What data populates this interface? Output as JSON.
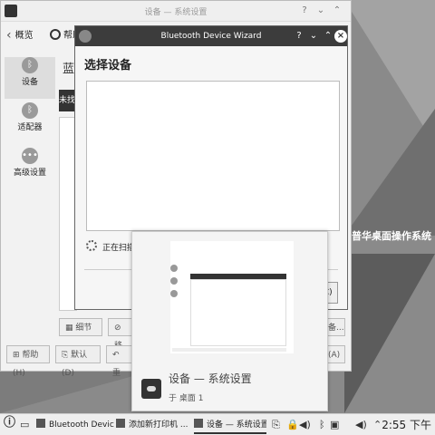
{
  "settings_window": {
    "title": "设备 — 系统设置",
    "back_label": "概览",
    "help_label": "帮助",
    "sidebar_items": [
      {
        "label": "设备",
        "icon": "bluetooth-icon"
      },
      {
        "label": "适配器",
        "icon": "bluetooth-icon"
      },
      {
        "label": "高级设置",
        "icon": "more-icon"
      }
    ],
    "page_title": "蓝牙",
    "dark_button_label": "未找到",
    "details_label": "细节",
    "remove_label": "移",
    "add_label": "备...",
    "bottom_buttons": {
      "help": "帮助(H)",
      "defaults": "默认(D)",
      "reset": "重",
      "apply": "(A)"
    }
  },
  "wizard": {
    "title": "Bluetooth Device Wizard",
    "heading": "选择设备",
    "scanning_text": "正在扫描",
    "cancel_label": "(C)"
  },
  "desktop": {
    "brand_text": "普华桌面操作系统"
  },
  "preview": {
    "title": "设备  — 系统设置",
    "subtitle": "于 桌面 1"
  },
  "taskbar": {
    "tasks": [
      {
        "label": "Bluetooth Devic",
        "icon": "bluetooth-icon"
      },
      {
        "label": "添加新打印机 ...",
        "icon": "printer-icon"
      },
      {
        "label": "设备  — 系统设置",
        "icon": "settings-icon"
      }
    ],
    "clock": "2:55 下午"
  }
}
